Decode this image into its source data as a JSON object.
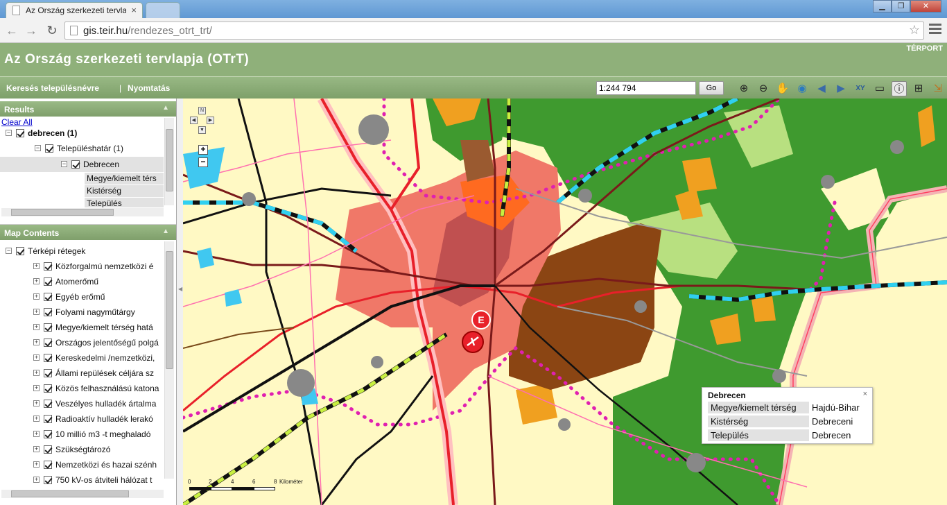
{
  "browser": {
    "tab_title": "Az Ország szerkezeti tervla",
    "url_host": "gis.teir.hu",
    "url_path": "/rendezes_otrt_trt/",
    "back_icon": "arrow-left-icon",
    "forward_icon": "arrow-right-icon",
    "reload_icon": "reload-icon"
  },
  "app": {
    "title": "Az Ország szerkezeti tervlapja (OTrT)",
    "terport_label": "TÉRPORT",
    "menu": {
      "search_label": "Keresés településnévre",
      "separator": "|",
      "print_label": "Nyomtatás"
    },
    "scale_value": "1:244 794",
    "go_label": "Go",
    "tools": [
      "zoom-in-icon",
      "zoom-out-icon",
      "pan-hand-icon",
      "full-extent-icon",
      "previous-extent-icon",
      "next-extent-icon",
      "xy-coordinate-icon",
      "select-icon",
      "info-icon",
      "measure-icon",
      "export-icon"
    ],
    "tool_xy_label": "XY"
  },
  "results": {
    "header": "Results",
    "clear_all": "Clear All",
    "query_label": "debrecen (1)",
    "layer_label": "Településhatár (1)",
    "feature_label": "Debrecen",
    "attributes": [
      "Megye/kiemelt térs",
      "Kistérség",
      "Település"
    ]
  },
  "map_contents": {
    "header": "Map Contents",
    "root_label": "Térképi rétegek",
    "layers": [
      "Közforgalmú nemzetközi é",
      "Atomerőmű",
      "Egyéb erőmű",
      "Folyami nagyműtárgy",
      "Megye/kiemelt térség hatá",
      "Országos jelentőségű polgá",
      "Kereskedelmi /nemzetközi,",
      "Állami repülések céljára sz",
      "Közös felhasználású katona",
      "Veszélyes hulladék ártalma",
      "Radioaktív hulladék lerakó",
      "10 millió m3 -t meghaladó",
      "Szükségtározó",
      "Nemzetközi és hazai szénh",
      "750 kV-os átviteli hálózat t"
    ]
  },
  "map": {
    "popup": {
      "title": "Debrecen",
      "close": "×",
      "rows": [
        {
          "key": "Megye/kiemelt térség",
          "value": "Hajdú-Bihar"
        },
        {
          "key": "Kistérség",
          "value": "Debreceni"
        },
        {
          "key": "Település",
          "value": "Debrecen"
        }
      ]
    },
    "scalebar": {
      "ticks": [
        "0",
        "2",
        "4",
        "6",
        "8"
      ],
      "unit": "Kilométer"
    },
    "marker_letter": "E",
    "colors": {
      "background": "#fff9c4",
      "forest": "#3a9a2a",
      "urban": "#f08070",
      "agri": "#8b4513",
      "orange": "#f0a020",
      "road_red": "#e8202a",
      "border_pink": "#e020b0",
      "rail_cyan": "#30d0f0"
    }
  }
}
